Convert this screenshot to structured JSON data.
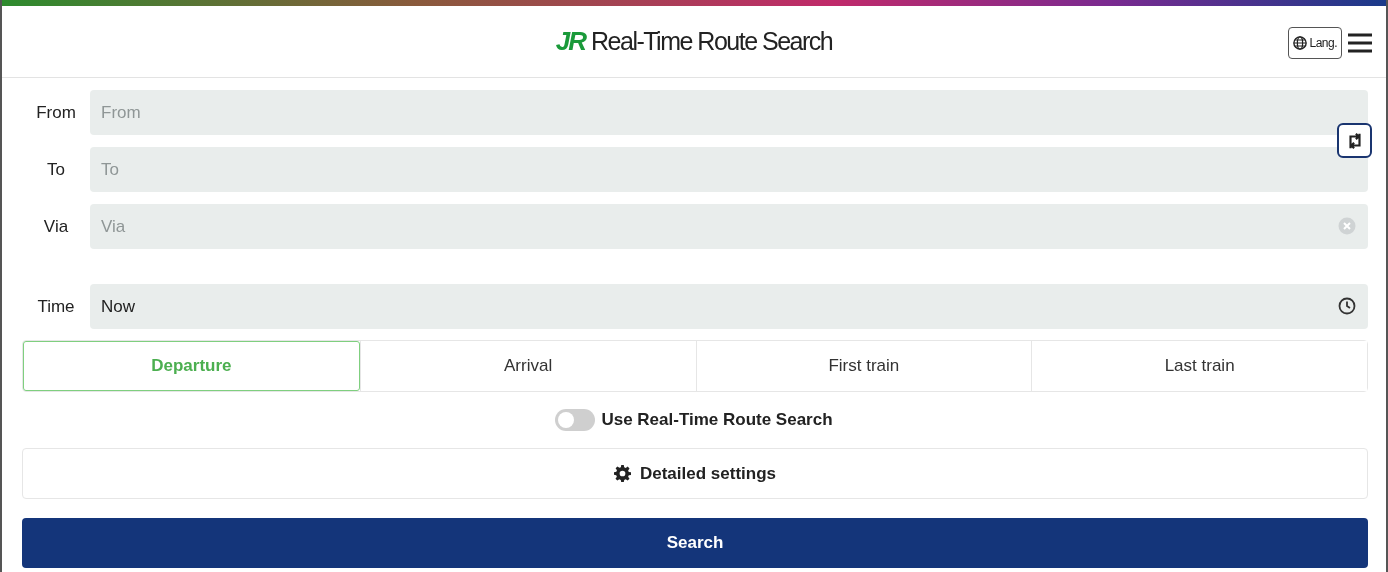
{
  "header": {
    "logo": "JR",
    "title": "Real-Time Route Search",
    "lang_button": "Lang."
  },
  "fields": [
    {
      "kind": "text",
      "label": "From",
      "placeholder": "From"
    },
    {
      "kind": "text",
      "label": "To",
      "placeholder": "To"
    },
    {
      "kind": "clearable",
      "label": "Via",
      "placeholder": "Via"
    },
    {
      "kind": "time",
      "label": "Time",
      "value": "Now"
    }
  ],
  "tabs": [
    {
      "label": "Departure",
      "selected": true
    },
    {
      "label": "Arrival",
      "selected": false
    },
    {
      "label": "First train",
      "selected": false
    },
    {
      "label": "Last train",
      "selected": false
    }
  ],
  "realtime_toggle": {
    "label": "Use Real-Time Route Search",
    "on": false
  },
  "detailed_settings": "Detailed settings",
  "search_button": "Search"
}
